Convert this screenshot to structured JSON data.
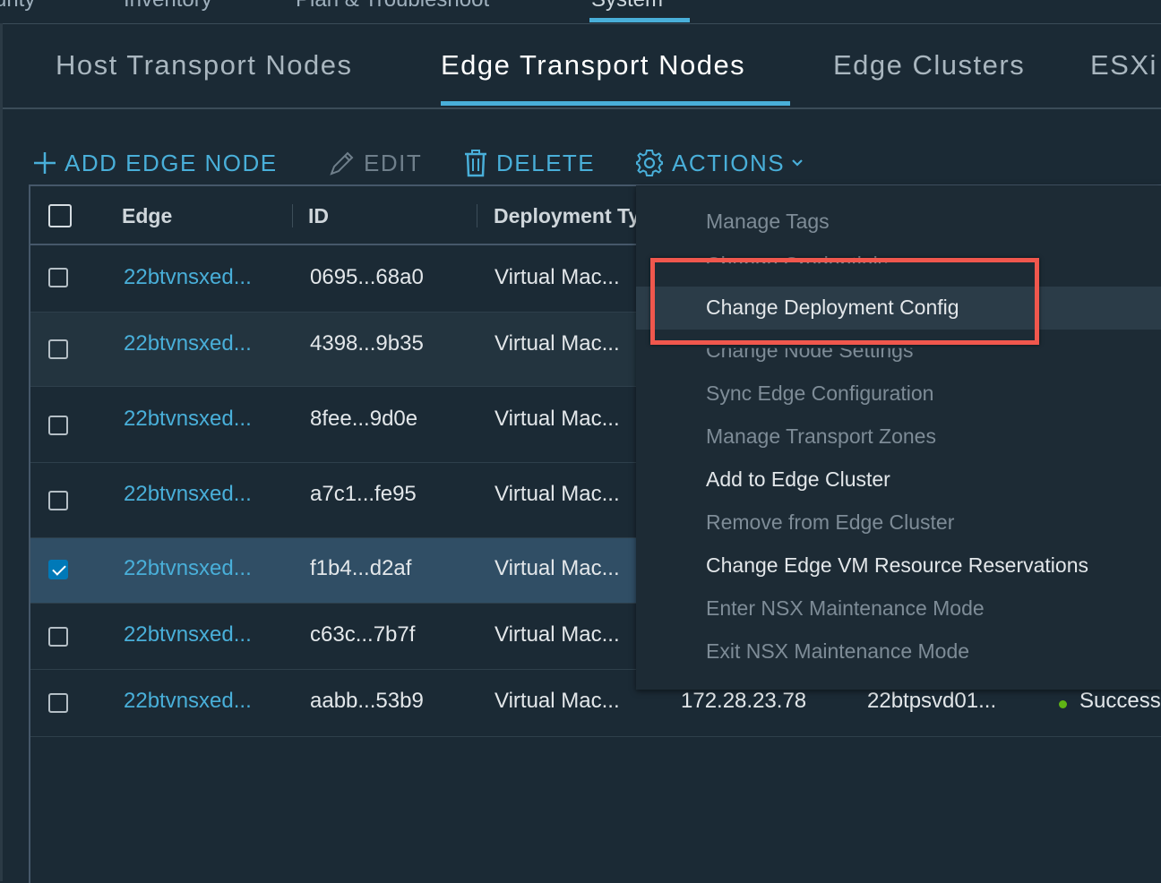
{
  "topnav": {
    "items": [
      "urity",
      "Inventory",
      "Plan & Troubleshoot",
      "System"
    ]
  },
  "subtabs": [
    "Host Transport Nodes",
    "Edge Transport Nodes",
    "Edge Clusters",
    "ESXi"
  ],
  "toolbar": {
    "add_label": "ADD EDGE NODE",
    "edit_label": "EDIT",
    "delete_label": "DELETE",
    "actions_label": "ACTIONS"
  },
  "columns": [
    "Edge",
    "ID",
    "Deployment Type"
  ],
  "rows": [
    {
      "edge": "22btvnsxed...",
      "id": "0695...68a0",
      "deployment": "Virtual Mac...",
      "checked": false
    },
    {
      "edge": "22btvnsxed...",
      "id": "4398...9b35",
      "deployment": "Virtual Mac...",
      "checked": false
    },
    {
      "edge": "22btvnsxed...",
      "id": "8fee...9d0e",
      "deployment": "Virtual Mac...",
      "checked": false
    },
    {
      "edge": "22btvnsxed...",
      "id": "a7c1...fe95",
      "deployment": "Virtual Mac...",
      "checked": false
    },
    {
      "edge": "22btvnsxed...",
      "id": "f1b4...d2af",
      "deployment": "Virtual Mac...",
      "checked": true
    },
    {
      "edge": "22btvnsxed...",
      "id": "c63c...7b7f",
      "deployment": "Virtual Mac...",
      "checked": false
    },
    {
      "edge": "22btvnsxed...",
      "id": "aabb...53b9",
      "deployment": "Virtual Mac...",
      "checked": false,
      "management_ip": "172.28.23.78",
      "host": "22btpsvd01...",
      "status": "Success"
    }
  ],
  "actions_menu": [
    {
      "label": "Manage Tags",
      "enabled": false
    },
    {
      "label": "Change Credentials",
      "enabled": false
    },
    {
      "label": "Change Deployment Config",
      "enabled": true
    },
    {
      "label": "Change Node Settings",
      "enabled": false
    },
    {
      "label": "Sync Edge Configuration",
      "enabled": false
    },
    {
      "label": "Manage Transport Zones",
      "enabled": false
    },
    {
      "label": "Add to Edge Cluster",
      "enabled": true
    },
    {
      "label": "Remove from Edge Cluster",
      "enabled": false
    },
    {
      "label": "Change Edge VM Resource Reservations",
      "enabled": true
    },
    {
      "label": "Enter NSX Maintenance Mode",
      "enabled": false
    },
    {
      "label": "Exit NSX Maintenance Mode",
      "enabled": false
    }
  ],
  "colors": {
    "accent": "#49afd9",
    "highlight_box": "#f0574d",
    "success": "#60b515"
  }
}
